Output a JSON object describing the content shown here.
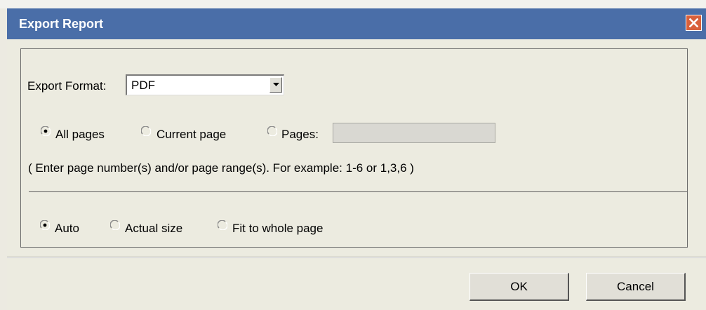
{
  "dialog": {
    "title": "Export Report"
  },
  "export_format": {
    "label": "Export Format:",
    "selected": "PDF"
  },
  "page_range": {
    "all_pages": "All pages",
    "current_page": "Current page",
    "pages": "Pages:",
    "pages_value": "",
    "selected": "all_pages",
    "hint": "( Enter page number(s) and/or page range(s). For example: 1-6 or 1,3,6 )"
  },
  "scaling": {
    "auto": "Auto",
    "actual_size": "Actual size",
    "fit_to_whole_page": "Fit to whole page",
    "selected": "auto"
  },
  "buttons": {
    "ok": "OK",
    "cancel": "Cancel"
  },
  "colors": {
    "titlebar": "#4a6ea8",
    "close_button": "#d9603b",
    "background": "#ecebe0"
  },
  "icons": {
    "close": "close-icon",
    "dropdown": "chevron-down-icon",
    "radio_selected": "radio-checked-icon",
    "radio_unselected": "radio-unchecked-icon"
  }
}
